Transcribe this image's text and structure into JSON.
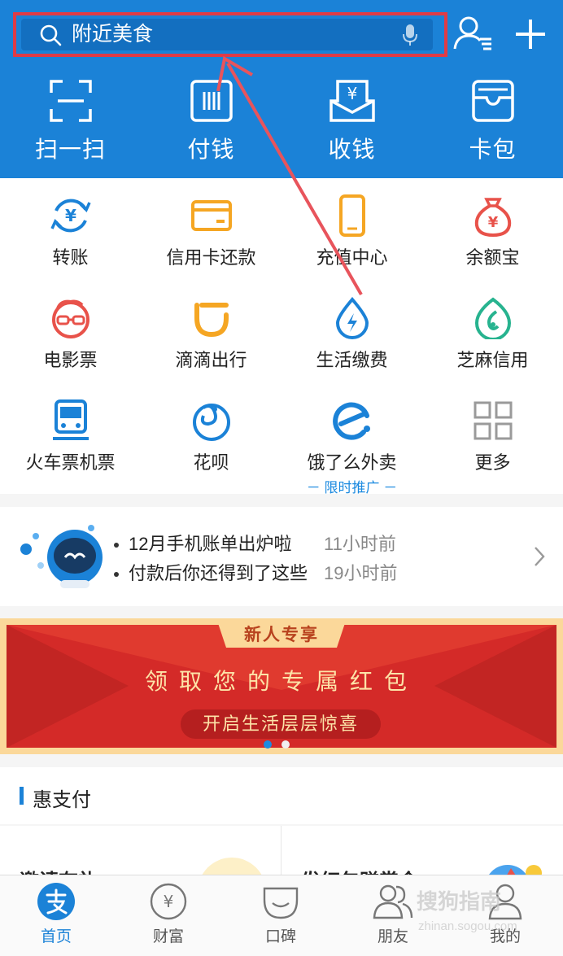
{
  "colors": {
    "primary": "#1b82d7",
    "highlight": "#e03b46",
    "banner_red": "#d42a28"
  },
  "search": {
    "placeholder": "附近美食",
    "icon": "search-icon",
    "mic_icon": "microphone-icon"
  },
  "header_icons": [
    "contacts-icon",
    "plus-icon"
  ],
  "quick_actions": [
    {
      "label": "扫一扫",
      "icon": "scan-icon"
    },
    {
      "label": "付钱",
      "icon": "barcode-icon"
    },
    {
      "label": "收钱",
      "icon": "collect-money-icon"
    },
    {
      "label": "卡包",
      "icon": "card-wallet-icon"
    }
  ],
  "apps": [
    {
      "label": "转账",
      "icon": "transfer-icon"
    },
    {
      "label": "信用卡还款",
      "icon": "credit-card-icon"
    },
    {
      "label": "充值中心",
      "icon": "phone-recharge-icon"
    },
    {
      "label": "余额宝",
      "icon": "money-bag-icon"
    },
    {
      "label": "电影票",
      "icon": "movie-icon"
    },
    {
      "label": "滴滴出行",
      "icon": "didi-icon"
    },
    {
      "label": "生活缴费",
      "icon": "utility-icon"
    },
    {
      "label": "芝麻信用",
      "icon": "sesame-credit-icon"
    },
    {
      "label": "火车票机票",
      "icon": "train-icon"
    },
    {
      "label": "花呗",
      "icon": "huabei-icon"
    },
    {
      "label": "饿了么外卖",
      "icon": "eleme-icon",
      "sublabel": "－ 限时推广 －"
    },
    {
      "label": "更多",
      "icon": "more-grid-icon"
    }
  ],
  "notices": [
    {
      "text": "12月手机账单出炉啦",
      "time": "11小时前"
    },
    {
      "text": "付款后你还得到了这些",
      "time": "19小时前"
    }
  ],
  "banner": {
    "tag": "新人专享",
    "title": "领取您的专属红包",
    "subtitle": "开启生活层层惊喜",
    "page_count": 2,
    "active_page": 1
  },
  "hui": {
    "title": "惠支付",
    "cards": [
      "邀请有礼",
      "发红包赚赏金"
    ]
  },
  "tabs": [
    {
      "label": "首页",
      "icon": "alipay-home-icon",
      "active": true
    },
    {
      "label": "财富",
      "icon": "wealth-icon",
      "active": false
    },
    {
      "label": "口碑",
      "icon": "koubei-icon",
      "active": false
    },
    {
      "label": "朋友",
      "icon": "friends-icon",
      "active": false
    },
    {
      "label": "我的",
      "icon": "profile-icon",
      "active": false
    }
  ],
  "watermark": {
    "text": "搜狗指南",
    "sub": "zhinan.sogou.com"
  }
}
